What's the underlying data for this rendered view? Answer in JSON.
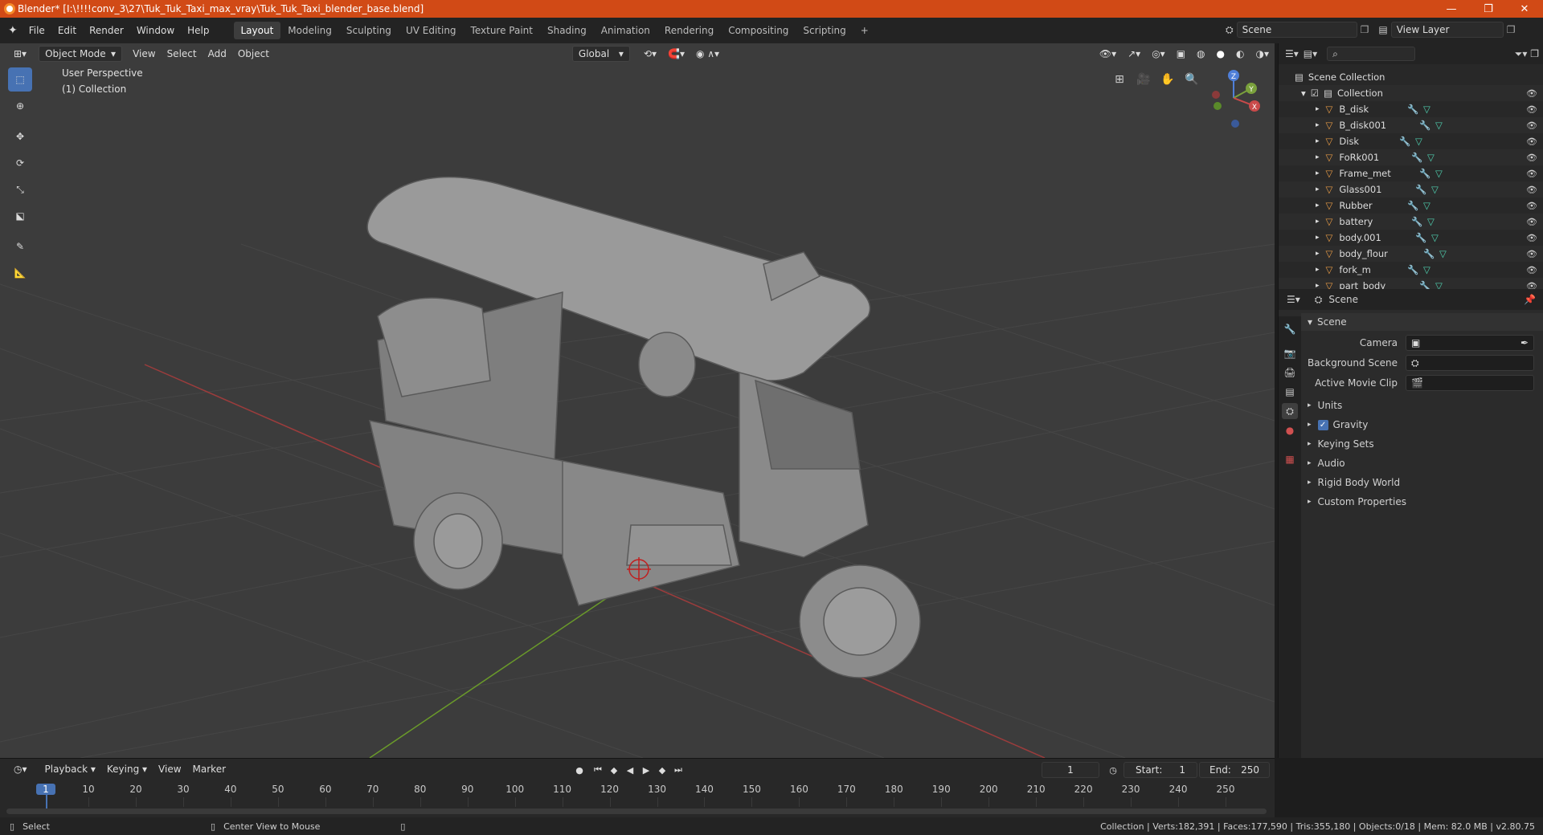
{
  "titlebar": {
    "title": "Blender* [I:\\!!!!conv_3\\27\\Tuk_Tuk_Taxi_max_vray\\Tuk_Tuk_Taxi_blender_base.blend]",
    "minimize": "—",
    "maximize": "❐",
    "close": "✕"
  },
  "menu": {
    "items": [
      "File",
      "Edit",
      "Render",
      "Window",
      "Help"
    ],
    "workspaces": [
      "Layout",
      "Modeling",
      "Sculpting",
      "UV Editing",
      "Texture Paint",
      "Shading",
      "Animation",
      "Rendering",
      "Compositing",
      "Scripting"
    ],
    "add_workspace": "+",
    "scene_label": "Scene",
    "view_layer_label": "View Layer"
  },
  "viewport": {
    "mode": "Object Mode",
    "menus": [
      "View",
      "Select",
      "Add",
      "Object"
    ],
    "transform_orientation": "Global",
    "overlay_title": "User Perspective",
    "overlay_collection": "(1) Collection",
    "gizmo": {
      "z": "Z",
      "y": "Y",
      "x": "X"
    }
  },
  "outliner": {
    "search_placeholder": "",
    "scene_collection": "Scene Collection",
    "collection": "Collection",
    "objects": [
      "B_disk",
      "B_disk001",
      "Disk",
      "FoRk001",
      "Frame_met",
      "Glass001",
      "Rubber",
      "battery",
      "body.001",
      "body_flour",
      "fork_m",
      "part_body"
    ]
  },
  "properties": {
    "header": "Scene",
    "panel_title": "Scene",
    "camera_label": "Camera",
    "background_scene_label": "Background Scene",
    "active_movie_clip_label": "Active Movie Clip",
    "sections": [
      "Units",
      "Gravity",
      "Keying Sets",
      "Audio",
      "Rigid Body World",
      "Custom Properties"
    ],
    "gravity_checked": true
  },
  "timeline": {
    "menus": [
      "Playback",
      "Keying",
      "View",
      "Marker"
    ],
    "current_frame": "1",
    "start_label": "Start:",
    "start_value": "1",
    "end_label": "End:",
    "end_value": "250",
    "ticks": [
      "1",
      "10",
      "20",
      "30",
      "40",
      "50",
      "60",
      "70",
      "80",
      "90",
      "100",
      "110",
      "120",
      "130",
      "140",
      "150",
      "160",
      "170",
      "180",
      "190",
      "200",
      "210",
      "220",
      "230",
      "240",
      "250"
    ]
  },
  "statusbar": {
    "select": "Select",
    "center_view": "Center View to Mouse",
    "stats": "Collection | Verts:182,391 | Faces:177,590 | Tris:355,180 | Objects:0/18 | Mem: 82.0 MB | v2.80.75"
  },
  "colors": {
    "accent": "#4772b3",
    "titlebar": "#d14a16",
    "viewport_bg": "#3c3c3c",
    "axis_x": "#b04040",
    "axis_y": "#6a9a2a"
  }
}
